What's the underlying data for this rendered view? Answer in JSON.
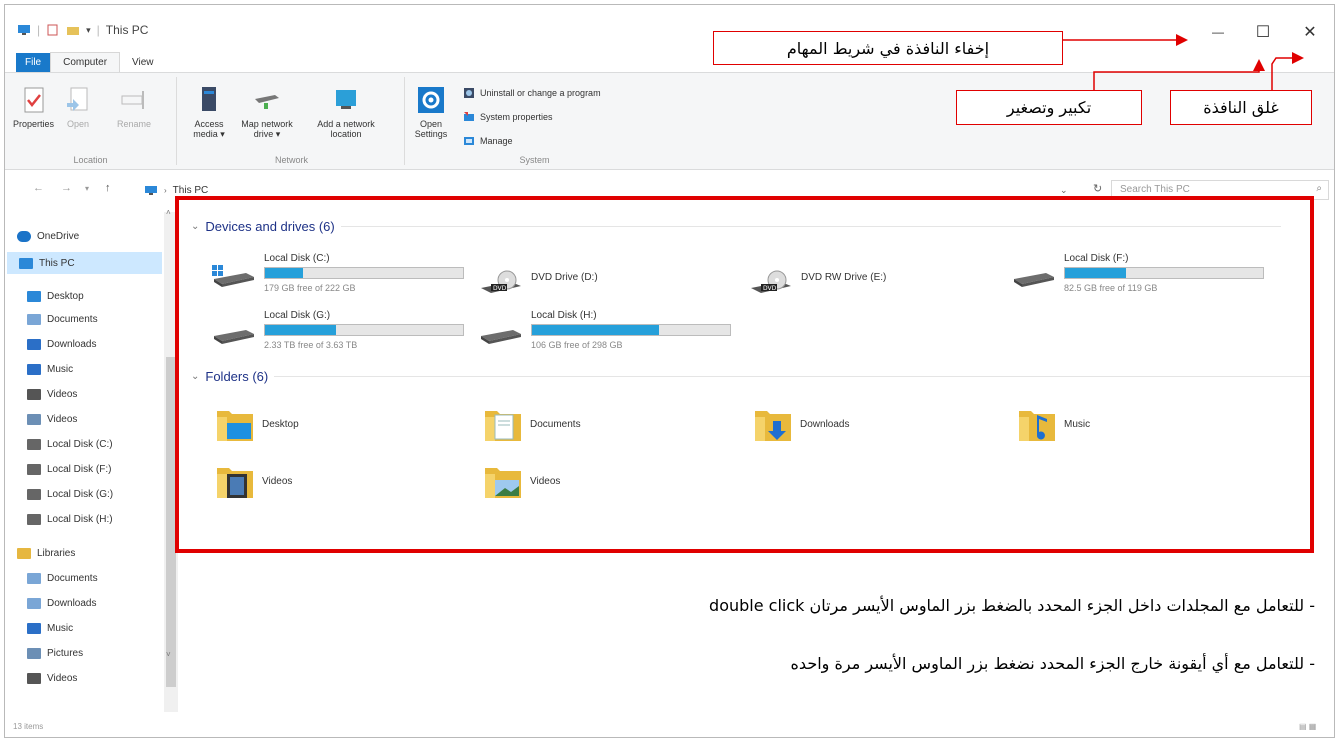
{
  "window": {
    "title": "This PC",
    "controls": {
      "minimize": "—",
      "maximize": "☐",
      "close": "✕"
    }
  },
  "ribbon": {
    "tabs": [
      "File",
      "Computer",
      "View"
    ],
    "groups": {
      "location": {
        "label": "Location",
        "buttons": [
          "Properties",
          "Open",
          "Rename"
        ]
      },
      "network": {
        "label": "Network",
        "buttons": [
          "Access media ▾",
          "Map network drive ▾",
          "Add a network location"
        ]
      },
      "system": {
        "label": "System",
        "open_settings": "Open Settings",
        "items": [
          "Uninstall or change a program",
          "System properties",
          "Manage"
        ]
      }
    }
  },
  "address": {
    "path": "This PC",
    "search_placeholder": "Search This PC"
  },
  "nav": {
    "items": [
      {
        "label": "OneDrive",
        "icon": "cloud-icon",
        "color": "#1a73c8"
      },
      {
        "label": "This PC",
        "icon": "computer-icon",
        "color": "#2b88d8",
        "selected": true
      },
      {
        "label": "Desktop",
        "icon": "desktop-folder-icon",
        "color": "#2b88d8"
      },
      {
        "label": "Documents",
        "icon": "documents-icon",
        "color": "#7aa6d6"
      },
      {
        "label": "Downloads",
        "icon": "download-arrow-icon",
        "color": "#2b6fc7"
      },
      {
        "label": "Music",
        "icon": "music-note-icon",
        "color": "#2b6fc7"
      },
      {
        "label": "Videos",
        "icon": "film-icon",
        "color": "#555"
      },
      {
        "label": "Videos",
        "icon": "picture-icon",
        "color": "#6c8fb5"
      },
      {
        "label": "Local Disk (C:)",
        "icon": "drive-icon",
        "color": "#666"
      },
      {
        "label": "Local Disk (F:)",
        "icon": "drive-icon",
        "color": "#666"
      },
      {
        "label": "Local Disk (G:)",
        "icon": "drive-icon",
        "color": "#666"
      },
      {
        "label": "Local Disk (H:)",
        "icon": "drive-icon",
        "color": "#666"
      },
      {
        "label": "Libraries",
        "icon": "libraries-icon",
        "color": "#e6b740"
      },
      {
        "label": "Documents",
        "icon": "documents-icon",
        "color": "#7aa6d6"
      },
      {
        "label": "Downloads",
        "icon": "documents-icon",
        "color": "#7aa6d6"
      },
      {
        "label": "Music",
        "icon": "music-note-icon",
        "color": "#2b6fc7"
      },
      {
        "label": "Pictures",
        "icon": "picture-icon",
        "color": "#6c8fb5"
      },
      {
        "label": "Videos",
        "icon": "film-icon",
        "color": "#555"
      }
    ]
  },
  "devices": {
    "header": "Devices and drives (6)",
    "drives": [
      {
        "name": "Local Disk (C:)",
        "type": "disk",
        "free": "179 GB free of 222 GB",
        "used_fraction": 0.19
      },
      {
        "name": "DVD Drive (D:)",
        "type": "dvd"
      },
      {
        "name": "DVD RW Drive (E:)",
        "type": "dvd"
      },
      {
        "name": "Local Disk (F:)",
        "type": "disk",
        "free": "82.5 GB free of 119 GB",
        "used_fraction": 0.31
      },
      {
        "name": "Local Disk (G:)",
        "type": "disk",
        "free": "2.33 TB free of 3.63 TB",
        "used_fraction": 0.36
      },
      {
        "name": "Local Disk (H:)",
        "type": "disk",
        "free": "106 GB free of 298 GB",
        "used_fraction": 0.64
      }
    ]
  },
  "folders": {
    "header": "Folders (6)",
    "items": [
      {
        "name": "Desktop",
        "icon": "desktop-folder-icon"
      },
      {
        "name": "Documents",
        "icon": "documents-folder-icon"
      },
      {
        "name": "Downloads",
        "icon": "downloads-folder-icon"
      },
      {
        "name": "Music",
        "icon": "music-folder-icon"
      },
      {
        "name": "Videos",
        "icon": "videos-folder-icon"
      },
      {
        "name": "Videos",
        "icon": "pictures-folder-icon"
      }
    ]
  },
  "status": {
    "items_count": "13 items"
  },
  "annotations": {
    "minimize": "إخفاء النافذة في شريط المهام",
    "maximize": "تكبير وتصغير",
    "close": "غلق النافذة",
    "instruction_1": "- للتعامل مع المجلدات داخل الجزء المحدد بالضغط بزر الماوس الأيسر مرتان double click",
    "instruction_2": "- للتعامل مع أي أيقونة خارج الجزء المحدد نضغط بزر الماوس الأيسر مرة واحده"
  },
  "colors": {
    "accent": "#26a0da",
    "highlight": "#e00000",
    "file_tab": "#1979ca"
  }
}
